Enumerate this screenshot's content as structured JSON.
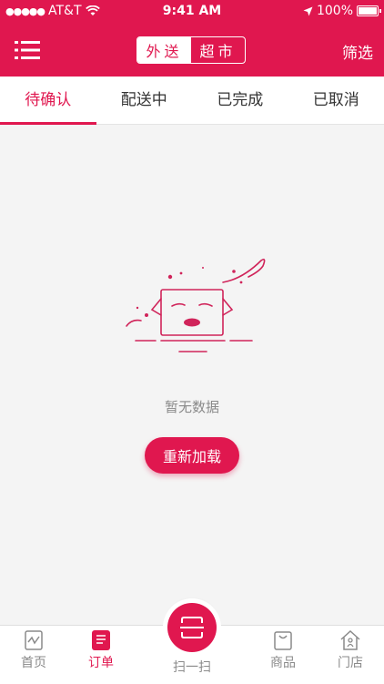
{
  "status_bar": {
    "carrier": "AT&T",
    "time": "9:41 AM",
    "battery": "100%"
  },
  "header": {
    "segments": [
      {
        "label": "外送",
        "active": true
      },
      {
        "label": "超市",
        "active": false
      }
    ],
    "filter_label": "筛选"
  },
  "tabs": [
    {
      "label": "待确认",
      "active": true
    },
    {
      "label": "配送中",
      "active": false
    },
    {
      "label": "已完成",
      "active": false
    },
    {
      "label": "已取消",
      "active": false
    }
  ],
  "empty_state": {
    "message": "暂无数据",
    "reload_label": "重新加载"
  },
  "tab_bar": {
    "items": [
      {
        "label": "首页",
        "icon": "home-chart-icon",
        "active": false
      },
      {
        "label": "订单",
        "icon": "order-icon",
        "active": true
      },
      {
        "label": "扫一扫",
        "icon": "scan-icon",
        "active": false
      },
      {
        "label": "商品",
        "icon": "bag-icon",
        "active": false
      },
      {
        "label": "门店",
        "icon": "store-icon",
        "active": false
      }
    ]
  },
  "colors": {
    "brand": "#e0174f",
    "background": "#f4f4f4",
    "muted_text": "#8a8a8a"
  }
}
